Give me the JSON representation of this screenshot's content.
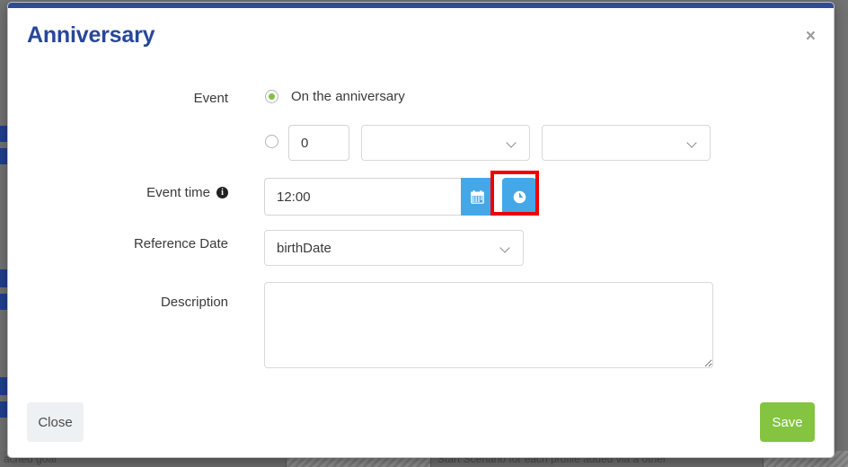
{
  "modal": {
    "title": "Anniversary",
    "close_icon_label": "×",
    "accent_blue": "#2d4b97",
    "title_color": "#27479a",
    "button_blue": "#44a8e8",
    "highlight_color": "#ef0000",
    "radio_green": "#7fc13f",
    "save_green": "#84c441"
  },
  "form": {
    "event": {
      "label": "Event",
      "options": [
        {
          "label": "On the anniversary",
          "selected": true
        },
        {
          "label": "",
          "selected": false
        }
      ],
      "offset_value": "0",
      "offset_unit": {
        "value": "",
        "placeholder": ""
      },
      "offset_direction": {
        "value": "",
        "placeholder": ""
      }
    },
    "event_time": {
      "label": "Event time",
      "info_icon": "info-icon",
      "value": "12:00",
      "calendar_button_icon": "calendar-icon",
      "clock_button_icon": "clock-icon"
    },
    "reference_date": {
      "label": "Reference Date",
      "value": "birthDate"
    },
    "description": {
      "label": "Description",
      "value": "",
      "placeholder": ""
    }
  },
  "footer": {
    "close_label": "Close",
    "save_label": "Save"
  },
  "background": {
    "row_text_left": "ached goal",
    "row_text_middle": "Start Scenario for each profile added via a other"
  }
}
